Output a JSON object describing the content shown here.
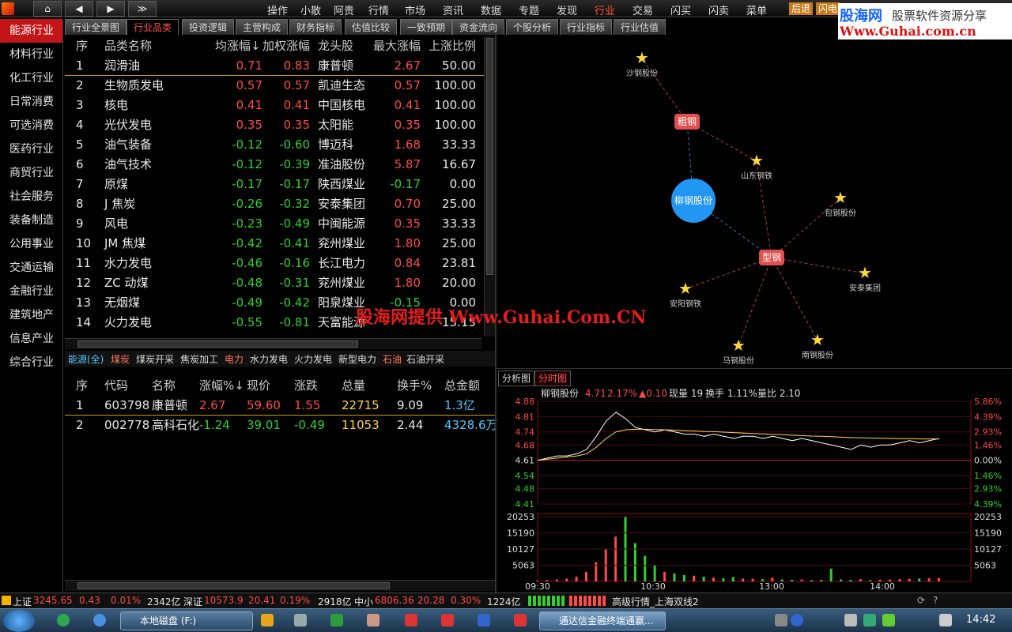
{
  "app": {
    "nav_buttons": {
      "home": "⌂",
      "back": "◀",
      "forward": "▶",
      "more": "≫"
    },
    "menu": [
      "操作",
      "小散",
      "阿贵",
      "行情",
      "市场",
      "资讯",
      "数据",
      "专题",
      "发现",
      "行业",
      "交易",
      "闪买",
      "闪卖",
      "菜单"
    ],
    "active_menu": "行业",
    "right_buttons": {
      "back_label": "后退",
      "flash_label": "闪电"
    },
    "brand": {
      "line1": "股海网",
      "line2": "股票软件资源分享",
      "line3": "Www.Guhai.com.cn"
    }
  },
  "sidebar": {
    "items": [
      "能源行业",
      "材料行业",
      "化工行业",
      "日常消费",
      "可选消费",
      "医药行业",
      "商贸行业",
      "社会服务",
      "装备制造",
      "公用事业",
      "交通运输",
      "金融行业",
      "建筑地产",
      "信息产业",
      "综合行业"
    ],
    "active": "能源行业"
  },
  "tabs": [
    "行业全景图",
    "行业品类",
    "投资逻辑",
    "主营构成",
    "财务指标",
    "估值比较",
    "一致预期",
    "资金流向",
    "个股分析",
    "行业指标",
    "行业估值"
  ],
  "active_tab": "行业品类",
  "category_table": {
    "headers": [
      "序",
      "品类名称",
      "均涨幅↓",
      "加权涨幅",
      "龙头股",
      "最大涨幅",
      "上涨比例"
    ],
    "rows": [
      [
        "1",
        "润滑油",
        "0.71",
        "0.83",
        "康普顿",
        "2.67",
        "50.00"
      ],
      [
        "2",
        "生物质发电",
        "0.57",
        "0.57",
        "凯迪生态",
        "0.57",
        "100.00"
      ],
      [
        "3",
        "核电",
        "0.41",
        "0.41",
        "中国核电",
        "0.41",
        "100.00"
      ],
      [
        "4",
        "光伏发电",
        "0.35",
        "0.35",
        "太阳能",
        "0.35",
        "100.00"
      ],
      [
        "5",
        "油气装备",
        "-0.12",
        "-0.60",
        "博迈科",
        "1.68",
        "33.33"
      ],
      [
        "6",
        "油气技术",
        "-0.12",
        "-0.39",
        "准油股份",
        "5.87",
        "16.67"
      ],
      [
        "7",
        "原煤",
        "-0.17",
        "-0.17",
        "陕西煤业",
        "-0.17",
        "0.00"
      ],
      [
        "8",
        "J 焦炭",
        "-0.26",
        "-0.32",
        "安泰集团",
        "0.70",
        "25.00"
      ],
      [
        "9",
        "风电",
        "-0.23",
        "-0.49",
        "中闽能源",
        "0.35",
        "33.33"
      ],
      [
        "10",
        "JM 焦煤",
        "-0.42",
        "-0.41",
        "兖州煤业",
        "1.80",
        "25.00"
      ],
      [
        "11",
        "水力发电",
        "-0.46",
        "-0.16",
        "长江电力",
        "0.84",
        "23.81"
      ],
      [
        "12",
        "ZC 动煤",
        "-0.48",
        "-0.31",
        "兖州煤业",
        "1.80",
        "20.00"
      ],
      [
        "13",
        "无烟煤",
        "-0.49",
        "-0.42",
        "阳泉煤业",
        "-0.15",
        "0.00"
      ],
      [
        "14",
        "火力发电",
        "-0.55",
        "-0.81",
        "天富能源",
        "",
        "15.15"
      ]
    ]
  },
  "sub_tabs": [
    "能源(全)",
    "煤炭",
    "煤炭开采",
    "焦炭加工",
    "电力",
    "水力发电",
    "火力发电",
    "新型电力",
    "石油",
    "石油开采"
  ],
  "stock_table": {
    "headers": [
      "序",
      "代码",
      "名称",
      "涨幅%↓",
      "现价",
      "涨跌",
      "总量",
      "换手%",
      "总金额"
    ],
    "rows": [
      [
        "1",
        "603798",
        "康普顿",
        "2.67",
        "59.60",
        "1.55",
        "22715",
        "9.09",
        "1.3亿"
      ],
      [
        "2",
        "002778",
        "高科石化",
        "-1.24",
        "39.01",
        "-0.49",
        "11053",
        "2.44",
        "4328.6万"
      ]
    ]
  },
  "watermark": "股海网提供 Www.Guhai.Com.CN",
  "graph": {
    "center": "柳钢股份",
    "hubs": [
      "粗钢",
      "型钢"
    ],
    "leaves": [
      "沙钢股份",
      "山东钢铁",
      "包钢股份",
      "安泰集团",
      "安阳钢铁",
      "马钢股份",
      "南钢股份"
    ]
  },
  "chart_tabs": [
    "分析图",
    "分时图"
  ],
  "active_chart_tab": "分时图",
  "quote_line": {
    "name": "柳钢股份",
    "price": "4.71",
    "pct": "2.17%",
    "chg": "▲0.10",
    "now_vol": "现量 19",
    "turnover": "换手 1.11%",
    "vol_ratio": "量比 2.10"
  },
  "chart_data": {
    "type": "line",
    "title": "",
    "price_ticks_left": [
      "4.88",
      "4.81",
      "4.74",
      "4.68",
      "4.61",
      "4.54",
      "4.48",
      "4.41"
    ],
    "pct_ticks_right": [
      "5.86%",
      "4.39%",
      "2.93%",
      "1.46%",
      "0.00%",
      "1.46%",
      "2.93%",
      "4.39%"
    ],
    "volume_ticks": [
      "20253",
      "15190",
      "10127",
      "5063"
    ],
    "time_ticks": [
      "09:30",
      "10:30",
      "13:00",
      "14:00"
    ],
    "ylim": [
      4.41,
      4.88
    ],
    "prev_close": 4.61,
    "series": [
      {
        "values": [
          4.61,
          4.62,
          4.63,
          4.63,
          4.64,
          4.66,
          4.72,
          4.79,
          4.83,
          4.8,
          4.76,
          4.75,
          4.74,
          4.75,
          4.74,
          4.73,
          4.73,
          4.72,
          4.73,
          4.72,
          4.71,
          4.72,
          4.72,
          4.71,
          4.72,
          4.71,
          4.7,
          4.71,
          4.7,
          4.69,
          4.68,
          4.67,
          4.66,
          4.68,
          4.67,
          4.68,
          4.68,
          4.69,
          4.7,
          4.69,
          4.7,
          4.71
        ]
      },
      {
        "values": [
          4.61,
          4.615,
          4.62,
          4.625,
          4.63,
          4.64,
          4.67,
          4.71,
          4.74,
          4.75,
          4.752,
          4.752,
          4.751,
          4.75,
          4.748,
          4.746,
          4.744,
          4.742,
          4.741,
          4.739,
          4.737,
          4.735,
          4.733,
          4.731,
          4.729,
          4.727,
          4.725,
          4.723,
          4.721,
          4.72,
          4.718,
          4.716,
          4.714,
          4.713,
          4.712,
          4.711,
          4.71,
          4.709,
          4.709,
          4.708,
          4.708,
          4.708
        ]
      }
    ],
    "volume": [
      200,
      400,
      600,
      900,
      1500,
      3000,
      6000,
      10000,
      14000,
      20253,
      12000,
      8000,
      5000,
      3000,
      2500,
      2000,
      1800,
      1500,
      1200,
      1000,
      1400,
      900,
      800,
      700,
      1200,
      600,
      500,
      600,
      400,
      500,
      4000,
      600,
      500,
      700,
      400,
      500,
      600,
      700,
      800,
      900,
      1000,
      1100
    ]
  },
  "statusbar": {
    "sh_label": "上证",
    "sh_val": "3245.65",
    "sh_chg": "0.43",
    "sh_pct": "0.01%",
    "sh_amt": "2342亿",
    "sz_label": "深证",
    "sz_val": "10573.9",
    "sz_chg": "20.41",
    "sz_pct": "0.19%",
    "sz_amt": "2918亿",
    "zx_label": "中小",
    "zx_val": "6806.36",
    "zx_chg": "20.28",
    "zx_pct": "0.30%",
    "zx_amt": "1224亿",
    "market_text": "高级行情_上海双线2"
  },
  "taskbar": {
    "task1": "本地磁盘 (F:)",
    "task2": "通达信金融终端通赢...",
    "clock": "14:42"
  },
  "colors": {
    "up": "#ff4a4a",
    "down": "#2ed12e",
    "accent": "#c31416",
    "node_blue": "#2196f3",
    "hub_red": "#e05050",
    "star": "#ffd83a"
  }
}
